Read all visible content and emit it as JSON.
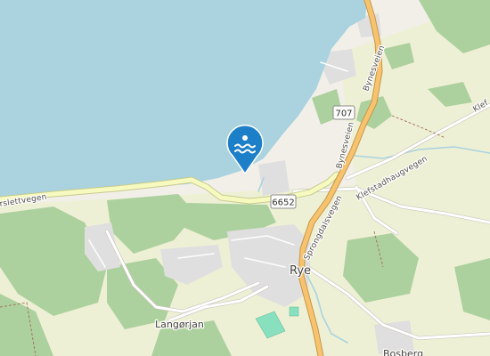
{
  "map": {
    "colors": {
      "water": "#aad3df",
      "land": "#f2efe9",
      "farmland": "#eef0d5",
      "forest": "#add19e",
      "residential": "#e0dfdf",
      "major_road": "#f7c36f",
      "road_casing": "#c5984b",
      "secondary_road": "#f7fabf",
      "minor_road": "#ffffff",
      "stream": "#aad3df",
      "pitch": "#88e0be",
      "poi_marker": "#1e7fc9"
    },
    "markers": [
      {
        "type": "swimming-marker",
        "icon": "swimming-icon"
      }
    ],
    "road_labels": {
      "bynesveien_upper": "Bynesveien",
      "bynesveien_lower": "Bynesveien",
      "sprongdalsvegen": "Sprongdalsvegen",
      "klefstadhaugvegen": "Klefstadhaugvegen",
      "klef_partial": "Klef",
      "slettvegen_partial": "rslettvegen"
    },
    "road_shields": {
      "r707": "707",
      "r6652": "6652"
    },
    "place_labels": {
      "rye": "Rye",
      "langorjan": "Langørjan",
      "bosberg_partial": "Bosberg"
    }
  }
}
